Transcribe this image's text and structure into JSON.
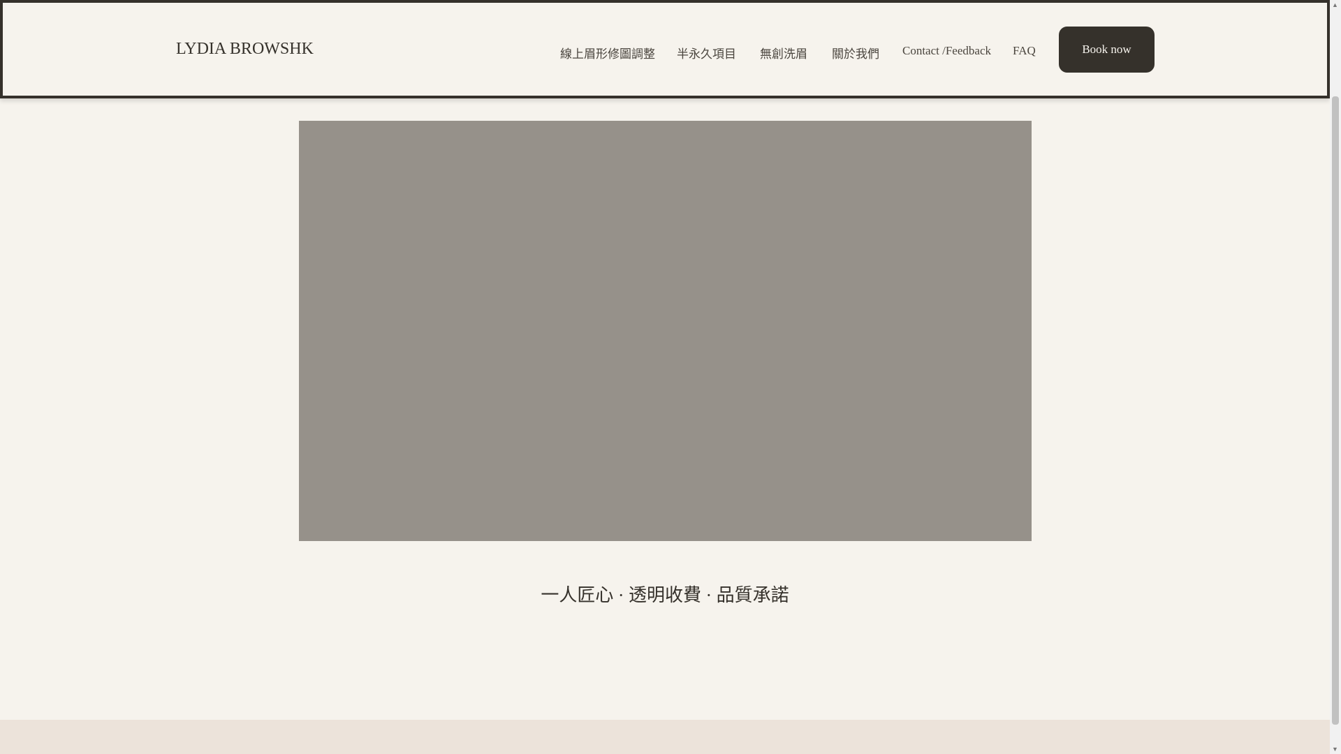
{
  "header": {
    "logo": "LYDIA BROWSHK",
    "nav": [
      "線上眉形修圖調整",
      "半永久項目",
      "無創洗眉",
      "關於我們",
      "Contact /Feedback",
      "FAQ"
    ],
    "book_label": "Book now"
  },
  "hero": {
    "tagline": "一人匠心 · 透明收費 · 品質承諾"
  },
  "colors": {
    "accent": "#35312b",
    "background": "#f6f3ed",
    "image_placeholder": "#96918a",
    "band": "#ece3da"
  }
}
